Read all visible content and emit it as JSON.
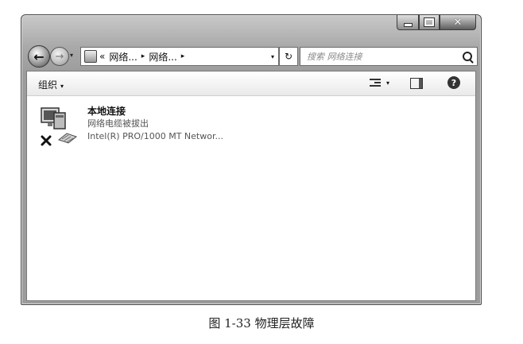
{
  "window": {
    "caption": {
      "minimize_icon": "minimize-icon",
      "maximize_icon": "maximize-icon",
      "close_glyph": "✕"
    }
  },
  "nav": {
    "back_glyph": "←",
    "forward_glyph": "→",
    "dropdown_glyph": "▾",
    "address": {
      "prefix": "«",
      "crumbs": [
        "网络...",
        "网络..."
      ],
      "separator": "▸"
    },
    "refresh_glyph": "↻",
    "search_placeholder": "搜索 网络连接"
  },
  "toolbar": {
    "organize_label": "组织",
    "organize_arrow": "▾",
    "view_drop": "▾",
    "help_glyph": "?"
  },
  "connection": {
    "name": "本地连接",
    "status": "网络电缆被拔出",
    "device": "Intel(R) PRO/1000 MT Networ..."
  },
  "figure_caption": "图 1-33    物理层故障",
  "colors": {
    "window_frame": "#a9a9a9",
    "error_x": "#111111"
  }
}
